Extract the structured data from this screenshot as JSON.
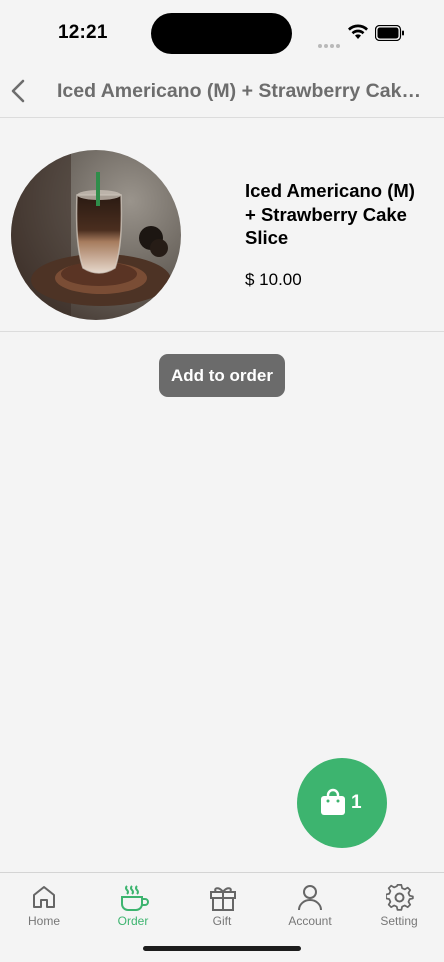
{
  "status_bar": {
    "time": "12:21"
  },
  "nav": {
    "title": "Iced Americano (M) + Strawberry Cake..."
  },
  "product": {
    "name": "Iced Americano (M) + Strawberry Cake Slice",
    "price": "$ 10.00"
  },
  "actions": {
    "add_to_order_label": "Add to order"
  },
  "cart": {
    "count": "1",
    "icon": "shopping-bag-icon",
    "color": "#3db46f"
  },
  "tabs": [
    {
      "label": "Home",
      "icon": "home-icon",
      "active": false
    },
    {
      "label": "Order",
      "icon": "coffee-cup-icon",
      "active": true
    },
    {
      "label": "Gift",
      "icon": "gift-icon",
      "active": false
    },
    {
      "label": "Account",
      "icon": "person-icon",
      "active": false
    },
    {
      "label": "Setting",
      "icon": "gear-icon",
      "active": false
    }
  ],
  "colors": {
    "accent": "#3db46f",
    "button": "#6b6b6b",
    "background": "#f4f4f4"
  }
}
